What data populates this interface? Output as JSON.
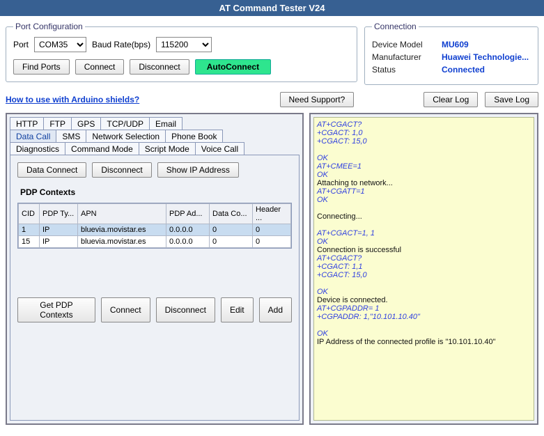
{
  "title": "AT Command Tester V24",
  "portConfig": {
    "legend": "Port Configuration",
    "portLabel": "Port",
    "portValue": "COM35",
    "baudLabel": "Baud Rate(bps)",
    "baudValue": "115200",
    "findPorts": "Find Ports",
    "connect": "Connect",
    "disconnect": "Disconnect",
    "autoConnect": "AutoConnect"
  },
  "connection": {
    "legend": "Connection",
    "modelLabel": "Device Model",
    "modelValue": "MU609",
    "manufLabel": "Manufacturer",
    "manufValue": "Huawei Technologie...",
    "statusLabel": "Status",
    "statusValue": "Connected"
  },
  "mid": {
    "arduinoLink": "How to use with Arduino shields?",
    "needSupport": "Need Support?",
    "clearLog": "Clear Log",
    "saveLog": "Save Log"
  },
  "tabs": {
    "row1": [
      "HTTP",
      "FTP",
      "GPS",
      "TCP/UDP",
      "Email"
    ],
    "row2": [
      "Data Call",
      "SMS",
      "Network Selection",
      "Phone Book"
    ],
    "row3": [
      "Diagnostics",
      "Command Mode",
      "Script Mode",
      "Voice Call"
    ],
    "active": "Data Call"
  },
  "dataCall": {
    "dataConnect": "Data Connect",
    "disconnect": "Disconnect",
    "showIp": "Show IP Address",
    "pdpTitle": "PDP Contexts",
    "headers": [
      "CID",
      "PDP Ty...",
      "APN",
      "PDP Ad...",
      "Data Co...",
      "Header ..."
    ],
    "rows": [
      {
        "cid": "1",
        "pdpType": "IP",
        "apn": "bluevia.movistar.es",
        "pdpAddr": "0.0.0.0",
        "dataCo": "0",
        "header": "0",
        "sel": true
      },
      {
        "cid": "15",
        "pdpType": "IP",
        "apn": "bluevia.movistar.es",
        "pdpAddr": "0.0.0.0",
        "dataCo": "0",
        "header": "0",
        "sel": false
      }
    ],
    "getPdp": "Get PDP Contexts",
    "connect": "Connect",
    "disconnect2": "Disconnect",
    "edit": "Edit",
    "add": "Add"
  },
  "log": [
    {
      "cls": "cmd",
      "text": "AT+CGACT?"
    },
    {
      "cls": "cmd",
      "text": "+CGACT: 1,0"
    },
    {
      "cls": "cmd",
      "text": "+CGACT: 15,0"
    },
    {
      "cls": "cmd",
      "text": ""
    },
    {
      "cls": "ok",
      "text": "OK"
    },
    {
      "cls": "cmd",
      "text": "AT+CMEE=1"
    },
    {
      "cls": "ok",
      "text": "OK"
    },
    {
      "cls": "txt",
      "text": "Attaching to network..."
    },
    {
      "cls": "cmd",
      "text": "AT+CGATT=1"
    },
    {
      "cls": "ok",
      "text": "OK"
    },
    {
      "cls": "txt",
      "text": ""
    },
    {
      "cls": "txt",
      "text": "Connecting..."
    },
    {
      "cls": "txt",
      "text": ""
    },
    {
      "cls": "cmd",
      "text": "AT+CGACT=1, 1"
    },
    {
      "cls": "ok",
      "text": "OK"
    },
    {
      "cls": "txt",
      "text": "Connection is successful"
    },
    {
      "cls": "cmd",
      "text": "AT+CGACT?"
    },
    {
      "cls": "cmd",
      "text": "+CGACT: 1,1"
    },
    {
      "cls": "cmd",
      "text": "+CGACT: 15,0"
    },
    {
      "cls": "cmd",
      "text": ""
    },
    {
      "cls": "ok",
      "text": "OK"
    },
    {
      "cls": "txt",
      "text": "Device is connected."
    },
    {
      "cls": "cmd",
      "text": "AT+CGPADDR= 1"
    },
    {
      "cls": "cmd",
      "text": "+CGPADDR: 1,\"10.101.10.40\""
    },
    {
      "cls": "cmd",
      "text": ""
    },
    {
      "cls": "ok",
      "text": "OK"
    },
    {
      "cls": "txt",
      "text": "IP Address of the connected profile is \"10.101.10.40\""
    }
  ]
}
